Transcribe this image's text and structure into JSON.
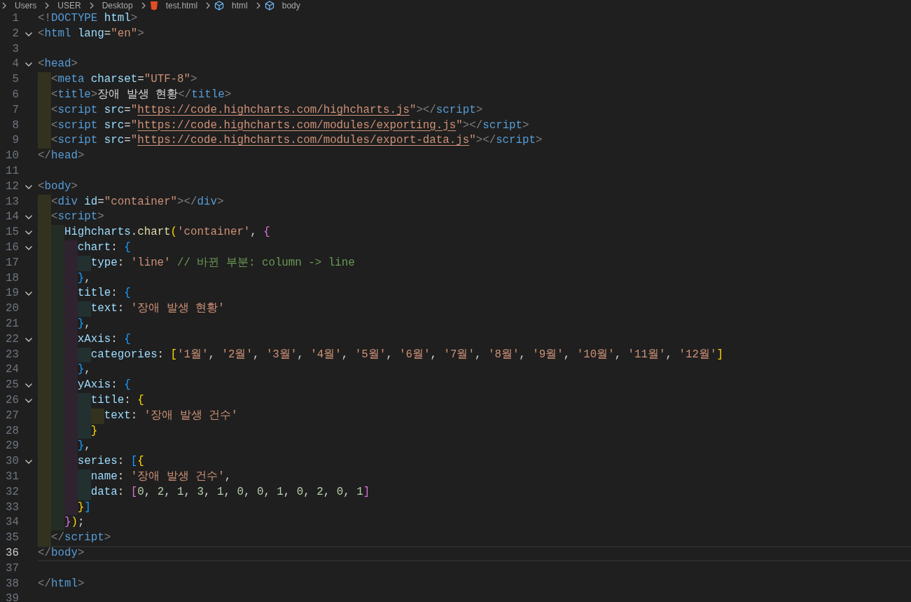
{
  "breadcrumb": [
    {
      "label": "Users",
      "kind": "folder"
    },
    {
      "label": "USER",
      "kind": "folder"
    },
    {
      "label": "Desktop",
      "kind": "folder"
    },
    {
      "label": "test.html",
      "kind": "file"
    },
    {
      "label": "html",
      "kind": "element"
    },
    {
      "label": "body",
      "kind": "element"
    }
  ],
  "lines": [
    {
      "number": "1",
      "foldable": false,
      "current": false,
      "tokens": [
        {
          "text": "<!",
          "kind": "punct"
        },
        {
          "text": "DOCTYPE",
          "kind": "tag"
        },
        {
          "text": " html",
          "kind": "attr"
        },
        {
          "text": ">",
          "kind": "punct"
        }
      ]
    },
    {
      "number": "2",
      "foldable": true,
      "current": false,
      "tokens": [
        {
          "text": "<",
          "kind": "punct"
        },
        {
          "text": "html",
          "kind": "tag"
        },
        {
          "text": " lang",
          "kind": "attr"
        },
        {
          "text": "=",
          "kind": "plain"
        },
        {
          "text": "\"en\"",
          "kind": "string"
        },
        {
          "text": ">",
          "kind": "punct"
        }
      ]
    },
    {
      "number": "3",
      "foldable": false,
      "current": false
    },
    {
      "number": "4",
      "foldable": true,
      "current": false,
      "tokens": [
        {
          "text": "<",
          "kind": "punct"
        },
        {
          "text": "head",
          "kind": "tag"
        },
        {
          "text": ">",
          "kind": "punct"
        }
      ]
    },
    {
      "number": "5",
      "foldable": false,
      "current": false,
      "indent_guides": [
        {
          "color": "#32321f"
        }
      ],
      "tokens": [
        {
          "text": "<",
          "kind": "punct"
        },
        {
          "text": "meta",
          "kind": "tag"
        },
        {
          "text": " charset",
          "kind": "attr"
        },
        {
          "text": "=",
          "kind": "plain"
        },
        {
          "text": "\"UTF-8\"",
          "kind": "string"
        },
        {
          "text": ">",
          "kind": "punct"
        }
      ]
    },
    {
      "number": "6",
      "foldable": false,
      "current": false,
      "indent_guides": [
        {
          "color": "#32321f"
        }
      ],
      "tokens": [
        {
          "text": "<",
          "kind": "punct"
        },
        {
          "text": "title",
          "kind": "tag"
        },
        {
          "text": ">",
          "kind": "punct"
        },
        {
          "text": "장애 발생 현황",
          "kind": "plain"
        },
        {
          "text": "</",
          "kind": "punct"
        },
        {
          "text": "title",
          "kind": "tag"
        },
        {
          "text": ">",
          "kind": "punct"
        }
      ]
    },
    {
      "number": "7",
      "foldable": false,
      "current": false,
      "indent_guides": [
        {
          "color": "#32321f"
        }
      ],
      "tokens": [
        {
          "text": "<",
          "kind": "punct"
        },
        {
          "text": "script",
          "kind": "tag"
        },
        {
          "text": " src",
          "kind": "attr"
        },
        {
          "text": "=",
          "kind": "plain"
        },
        {
          "text": "\"",
          "kind": "string"
        },
        {
          "text": "https://code.highcharts.com/highcharts.js",
          "kind": "link"
        },
        {
          "text": "\"",
          "kind": "string"
        },
        {
          "text": "></",
          "kind": "punct"
        },
        {
          "text": "script",
          "kind": "tag"
        },
        {
          "text": ">",
          "kind": "punct"
        }
      ]
    },
    {
      "number": "8",
      "foldable": false,
      "current": false,
      "indent_guides": [
        {
          "color": "#32321f"
        }
      ],
      "tokens": [
        {
          "text": "<",
          "kind": "punct"
        },
        {
          "text": "script",
          "kind": "tag"
        },
        {
          "text": " src",
          "kind": "attr"
        },
        {
          "text": "=",
          "kind": "plain"
        },
        {
          "text": "\"",
          "kind": "string"
        },
        {
          "text": "https://code.highcharts.com/modules/exporting.js",
          "kind": "link"
        },
        {
          "text": "\"",
          "kind": "string"
        },
        {
          "text": "></",
          "kind": "punct"
        },
        {
          "text": "script",
          "kind": "tag"
        },
        {
          "text": ">",
          "kind": "punct"
        }
      ]
    },
    {
      "number": "9",
      "foldable": false,
      "current": false,
      "indent_guides": [
        {
          "color": "#32321f"
        }
      ],
      "tokens": [
        {
          "text": "<",
          "kind": "punct"
        },
        {
          "text": "script",
          "kind": "tag"
        },
        {
          "text": " src",
          "kind": "attr"
        },
        {
          "text": "=",
          "kind": "plain"
        },
        {
          "text": "\"",
          "kind": "string"
        },
        {
          "text": "https://code.highcharts.com/modules/export-data.js",
          "kind": "link"
        },
        {
          "text": "\"",
          "kind": "string"
        },
        {
          "text": "></",
          "kind": "punct"
        },
        {
          "text": "script",
          "kind": "tag"
        },
        {
          "text": ">",
          "kind": "punct"
        }
      ]
    },
    {
      "number": "10",
      "foldable": false,
      "current": false,
      "tokens": [
        {
          "text": "</",
          "kind": "punct"
        },
        {
          "text": "head",
          "kind": "tag"
        },
        {
          "text": ">",
          "kind": "punct"
        }
      ]
    },
    {
      "number": "11",
      "foldable": false,
      "current": false
    },
    {
      "number": "12",
      "foldable": true,
      "current": false,
      "tokens": [
        {
          "text": "<",
          "kind": "punct"
        },
        {
          "text": "body",
          "kind": "tag"
        },
        {
          "text": ">",
          "kind": "punct"
        }
      ]
    },
    {
      "number": "13",
      "foldable": false,
      "current": false,
      "indent_guides": [
        {
          "color": "#32321f"
        }
      ],
      "tokens": [
        {
          "text": "<",
          "kind": "punct"
        },
        {
          "text": "div",
          "kind": "tag"
        },
        {
          "text": " id",
          "kind": "attr"
        },
        {
          "text": "=",
          "kind": "plain"
        },
        {
          "text": "\"container\"",
          "kind": "string"
        },
        {
          "text": "></",
          "kind": "punct"
        },
        {
          "text": "div",
          "kind": "tag"
        },
        {
          "text": ">",
          "kind": "punct"
        }
      ]
    },
    {
      "number": "14",
      "foldable": true,
      "current": false,
      "indent_guides": [
        {
          "color": "#32321f"
        }
      ],
      "tokens": [
        {
          "text": "<",
          "kind": "punct"
        },
        {
          "text": "script",
          "kind": "tag"
        },
        {
          "text": ">",
          "kind": "punct"
        }
      ]
    },
    {
      "number": "15",
      "foldable": true,
      "current": false,
      "indent_guides": [
        {
          "color": "#32321f"
        },
        {
          "color": "#232d24"
        }
      ],
      "tokens": [
        {
          "text": "Highcharts",
          "kind": "attr"
        },
        {
          "text": ".",
          "kind": "plain"
        },
        {
          "text": "chart",
          "kind": "function"
        },
        {
          "text": "(",
          "kind": "bracket1"
        },
        {
          "text": "'container'",
          "kind": "string"
        },
        {
          "text": ",",
          "kind": "plain"
        },
        {
          "text": " {",
          "kind": "bracket2"
        }
      ]
    },
    {
      "number": "16",
      "foldable": true,
      "current": false,
      "indent_guides": [
        {
          "color": "#32321f"
        },
        {
          "color": "#232d24"
        },
        {
          "color": "#2e232e"
        }
      ],
      "tokens": [
        {
          "text": "chart",
          "kind": "attr"
        },
        {
          "text": ":",
          "kind": "plain"
        },
        {
          "text": " {",
          "kind": "bracket3"
        }
      ]
    },
    {
      "number": "17",
      "foldable": false,
      "current": false,
      "indent_guides": [
        {
          "color": "#32321f"
        },
        {
          "color": "#232d24"
        },
        {
          "color": "#2e232e"
        },
        {
          "color": "#223030"
        }
      ],
      "tokens": [
        {
          "text": "type",
          "kind": "attr"
        },
        {
          "text": ":",
          "kind": "plain"
        },
        {
          "text": " 'line'",
          "kind": "string"
        },
        {
          "text": " // 바뀐 부분: column -> line",
          "kind": "comment"
        }
      ]
    },
    {
      "number": "18",
      "foldable": false,
      "current": false,
      "indent_guides": [
        {
          "color": "#32321f"
        },
        {
          "color": "#232d24"
        },
        {
          "color": "#2e232e"
        }
      ],
      "tokens": [
        {
          "text": "}",
          "kind": "bracket3"
        },
        {
          "text": ",",
          "kind": "plain"
        }
      ]
    },
    {
      "number": "19",
      "foldable": true,
      "current": false,
      "indent_guides": [
        {
          "color": "#32321f"
        },
        {
          "color": "#232d24"
        },
        {
          "color": "#2e232e"
        }
      ],
      "tokens": [
        {
          "text": "title",
          "kind": "attr"
        },
        {
          "text": ":",
          "kind": "plain"
        },
        {
          "text": " {",
          "kind": "bracket3"
        }
      ]
    },
    {
      "number": "20",
      "foldable": false,
      "current": false,
      "indent_guides": [
        {
          "color": "#32321f"
        },
        {
          "color": "#232d24"
        },
        {
          "color": "#2e232e"
        },
        {
          "color": "#223030"
        }
      ],
      "tokens": [
        {
          "text": "text",
          "kind": "attr"
        },
        {
          "text": ":",
          "kind": "plain"
        },
        {
          "text": " '장애 발생 현황'",
          "kind": "string"
        }
      ]
    },
    {
      "number": "21",
      "foldable": false,
      "current": false,
      "indent_guides": [
        {
          "color": "#32321f"
        },
        {
          "color": "#232d24"
        },
        {
          "color": "#2e232e"
        }
      ],
      "tokens": [
        {
          "text": "}",
          "kind": "bracket3"
        },
        {
          "text": ",",
          "kind": "plain"
        }
      ]
    },
    {
      "number": "22",
      "foldable": true,
      "current": false,
      "indent_guides": [
        {
          "color": "#32321f"
        },
        {
          "color": "#232d24"
        },
        {
          "color": "#2e232e"
        }
      ],
      "tokens": [
        {
          "text": "xAxis",
          "kind": "attr"
        },
        {
          "text": ":",
          "kind": "plain"
        },
        {
          "text": " {",
          "kind": "bracket3"
        }
      ]
    },
    {
      "number": "23",
      "foldable": false,
      "current": false,
      "indent_guides": [
        {
          "color": "#32321f"
        },
        {
          "color": "#232d24"
        },
        {
          "color": "#2e232e"
        },
        {
          "color": "#223030"
        }
      ],
      "tokens": [
        {
          "text": "categories",
          "kind": "attr"
        },
        {
          "text": ":",
          "kind": "plain"
        },
        {
          "text": " [",
          "kind": "bracket1"
        },
        {
          "text": "'1월'",
          "kind": "string"
        },
        {
          "text": ",",
          "kind": "plain"
        },
        {
          "text": " '2월'",
          "kind": "string"
        },
        {
          "text": ",",
          "kind": "plain"
        },
        {
          "text": " '3월'",
          "kind": "string"
        },
        {
          "text": ",",
          "kind": "plain"
        },
        {
          "text": " '4월'",
          "kind": "string"
        },
        {
          "text": ",",
          "kind": "plain"
        },
        {
          "text": " '5월'",
          "kind": "string"
        },
        {
          "text": ",",
          "kind": "plain"
        },
        {
          "text": " '6월'",
          "kind": "string"
        },
        {
          "text": ",",
          "kind": "plain"
        },
        {
          "text": " '7월'",
          "kind": "string"
        },
        {
          "text": ",",
          "kind": "plain"
        },
        {
          "text": " '8월'",
          "kind": "string"
        },
        {
          "text": ",",
          "kind": "plain"
        },
        {
          "text": " '9월'",
          "kind": "string"
        },
        {
          "text": ",",
          "kind": "plain"
        },
        {
          "text": " '10월'",
          "kind": "string"
        },
        {
          "text": ",",
          "kind": "plain"
        },
        {
          "text": " '11월'",
          "kind": "string"
        },
        {
          "text": ",",
          "kind": "plain"
        },
        {
          "text": " '12월'",
          "kind": "string"
        },
        {
          "text": "]",
          "kind": "bracket1"
        }
      ]
    },
    {
      "number": "24",
      "foldable": false,
      "current": false,
      "indent_guides": [
        {
          "color": "#32321f"
        },
        {
          "color": "#232d24"
        },
        {
          "color": "#2e232e"
        }
      ],
      "tokens": [
        {
          "text": "}",
          "kind": "bracket3"
        },
        {
          "text": ",",
          "kind": "plain"
        }
      ]
    },
    {
      "number": "25",
      "foldable": true,
      "current": false,
      "indent_guides": [
        {
          "color": "#32321f"
        },
        {
          "color": "#232d24"
        },
        {
          "color": "#2e232e"
        }
      ],
      "tokens": [
        {
          "text": "yAxis",
          "kind": "attr"
        },
        {
          "text": ":",
          "kind": "plain"
        },
        {
          "text": " {",
          "kind": "bracket3"
        }
      ]
    },
    {
      "number": "26",
      "foldable": true,
      "current": false,
      "indent_guides": [
        {
          "color": "#32321f"
        },
        {
          "color": "#232d24"
        },
        {
          "color": "#2e232e"
        },
        {
          "color": "#223030"
        }
      ],
      "tokens": [
        {
          "text": "title",
          "kind": "attr"
        },
        {
          "text": ":",
          "kind": "plain"
        },
        {
          "text": " {",
          "kind": "bracket1"
        }
      ]
    },
    {
      "number": "27",
      "foldable": false,
      "current": false,
      "indent_guides": [
        {
          "color": "#32321f"
        },
        {
          "color": "#232d24"
        },
        {
          "color": "#2e232e"
        },
        {
          "color": "#223030"
        },
        {
          "color": "#32321f"
        }
      ],
      "tokens": [
        {
          "text": "text",
          "kind": "attr"
        },
        {
          "text": ":",
          "kind": "plain"
        },
        {
          "text": " '장애 발생 건수'",
          "kind": "string"
        }
      ]
    },
    {
      "number": "28",
      "foldable": false,
      "current": false,
      "indent_guides": [
        {
          "color": "#32321f"
        },
        {
          "color": "#232d24"
        },
        {
          "color": "#2e232e"
        },
        {
          "color": "#223030"
        }
      ],
      "tokens": [
        {
          "text": "}",
          "kind": "bracket1"
        }
      ]
    },
    {
      "number": "29",
      "foldable": false,
      "current": false,
      "indent_guides": [
        {
          "color": "#32321f"
        },
        {
          "color": "#232d24"
        },
        {
          "color": "#2e232e"
        }
      ],
      "tokens": [
        {
          "text": "}",
          "kind": "bracket3"
        },
        {
          "text": ",",
          "kind": "plain"
        }
      ]
    },
    {
      "number": "30",
      "foldable": true,
      "current": false,
      "indent_guides": [
        {
          "color": "#32321f"
        },
        {
          "color": "#232d24"
        },
        {
          "color": "#2e232e"
        }
      ],
      "tokens": [
        {
          "text": "series",
          "kind": "attr"
        },
        {
          "text": ":",
          "kind": "plain"
        },
        {
          "text": " [",
          "kind": "bracket3"
        },
        {
          "text": "{",
          "kind": "bracket1"
        }
      ]
    },
    {
      "number": "31",
      "foldable": false,
      "current": false,
      "indent_guides": [
        {
          "color": "#32321f"
        },
        {
          "color": "#232d24"
        },
        {
          "color": "#2e232e"
        },
        {
          "color": "#223030"
        }
      ],
      "tokens": [
        {
          "text": "name",
          "kind": "attr"
        },
        {
          "text": ":",
          "kind": "plain"
        },
        {
          "text": " '장애 발생 건수'",
          "kind": "string"
        },
        {
          "text": ",",
          "kind": "plain"
        }
      ]
    },
    {
      "number": "32",
      "foldable": false,
      "current": false,
      "indent_guides": [
        {
          "color": "#32321f"
        },
        {
          "color": "#232d24"
        },
        {
          "color": "#2e232e"
        },
        {
          "color": "#223030"
        }
      ],
      "tokens": [
        {
          "text": "data",
          "kind": "attr"
        },
        {
          "text": ":",
          "kind": "plain"
        },
        {
          "text": " [",
          "kind": "bracket2"
        },
        {
          "text": "0",
          "kind": "number"
        },
        {
          "text": ",",
          "kind": "plain"
        },
        {
          "text": " 2",
          "kind": "number"
        },
        {
          "text": ",",
          "kind": "plain"
        },
        {
          "text": " 1",
          "kind": "number"
        },
        {
          "text": ",",
          "kind": "plain"
        },
        {
          "text": " 3",
          "kind": "number"
        },
        {
          "text": ",",
          "kind": "plain"
        },
        {
          "text": " 1",
          "kind": "number"
        },
        {
          "text": ",",
          "kind": "plain"
        },
        {
          "text": " 0",
          "kind": "number"
        },
        {
          "text": ",",
          "kind": "plain"
        },
        {
          "text": " 0",
          "kind": "number"
        },
        {
          "text": ",",
          "kind": "plain"
        },
        {
          "text": " 1",
          "kind": "number"
        },
        {
          "text": ",",
          "kind": "plain"
        },
        {
          "text": " 0",
          "kind": "number"
        },
        {
          "text": ",",
          "kind": "plain"
        },
        {
          "text": " 2",
          "kind": "number"
        },
        {
          "text": ",",
          "kind": "plain"
        },
        {
          "text": " 0",
          "kind": "number"
        },
        {
          "text": ",",
          "kind": "plain"
        },
        {
          "text": " 1",
          "kind": "number"
        },
        {
          "text": "]",
          "kind": "bracket2"
        }
      ]
    },
    {
      "number": "33",
      "foldable": false,
      "current": false,
      "indent_guides": [
        {
          "color": "#32321f"
        },
        {
          "color": "#232d24"
        },
        {
          "color": "#2e232e"
        }
      ],
      "tokens": [
        {
          "text": "}",
          "kind": "bracket1"
        },
        {
          "text": "]",
          "kind": "bracket3"
        }
      ]
    },
    {
      "number": "34",
      "foldable": false,
      "current": false,
      "indent_guides": [
        {
          "color": "#32321f"
        },
        {
          "color": "#232d24"
        }
      ],
      "tokens": [
        {
          "text": "}",
          "kind": "bracket2"
        },
        {
          "text": ")",
          "kind": "bracket1"
        },
        {
          "text": ";",
          "kind": "plain"
        }
      ]
    },
    {
      "number": "35",
      "foldable": false,
      "current": false,
      "indent_guides": [
        {
          "color": "#32321f"
        }
      ],
      "tokens": [
        {
          "text": "</",
          "kind": "punct"
        },
        {
          "text": "script",
          "kind": "tag"
        },
        {
          "text": ">",
          "kind": "punct"
        }
      ]
    },
    {
      "number": "36",
      "foldable": false,
      "current": true,
      "tokens": [
        {
          "text": "</",
          "kind": "punct"
        },
        {
          "text": "body",
          "kind": "tag"
        },
        {
          "text": ">",
          "kind": "punct"
        }
      ]
    },
    {
      "number": "37",
      "foldable": false,
      "current": false
    },
    {
      "number": "38",
      "foldable": false,
      "current": false,
      "tokens": [
        {
          "text": "</",
          "kind": "punct"
        },
        {
          "text": "html",
          "kind": "tag"
        },
        {
          "text": ">",
          "kind": "punct"
        }
      ]
    },
    {
      "number": "39",
      "foldable": false,
      "current": false
    }
  ]
}
